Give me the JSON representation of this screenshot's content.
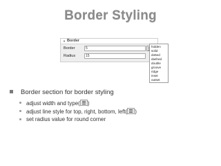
{
  "slide": {
    "title": "Border Styling"
  },
  "panel": {
    "header": "Border",
    "rows": [
      {
        "label": "Border",
        "value": "5"
      },
      {
        "label": "Radius",
        "value": "15"
      }
    ]
  },
  "dropdown": {
    "options": [
      "hidden",
      "solid",
      "dotted",
      "dashed",
      "double",
      "groove",
      "ridge",
      "inset",
      "outset"
    ]
  },
  "bullets": {
    "main": "Border section for border styling",
    "sub1_pre": "adjust width and type(",
    "sub1_post": ")",
    "sub2_pre": "adjust line style for top, right, bottom, left(",
    "sub2_post": ")",
    "sub3": "set radius value for round corner"
  },
  "icons": {
    "line_style_button": "line-style-icon"
  }
}
